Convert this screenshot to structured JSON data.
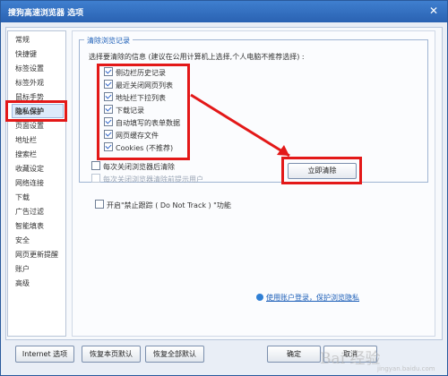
{
  "window": {
    "title": "搜狗高速浏览器 选项",
    "close": "✕"
  },
  "sidebar": {
    "items": [
      {
        "label": "常规"
      },
      {
        "label": "快捷键"
      },
      {
        "label": "标签设置"
      },
      {
        "label": "标签外观"
      },
      {
        "label": "鼠标手势"
      },
      {
        "label": "隐私保护"
      },
      {
        "label": "页面设置"
      },
      {
        "label": "地址栏"
      },
      {
        "label": "搜索栏"
      },
      {
        "label": "收藏设定"
      },
      {
        "label": "网络连接"
      },
      {
        "label": "下载"
      },
      {
        "label": "广告过滤"
      },
      {
        "label": "智能填表"
      },
      {
        "label": "安全"
      },
      {
        "label": "网页更新提醒"
      },
      {
        "label": "账户"
      },
      {
        "label": "高级"
      }
    ]
  },
  "privacy": {
    "group_title": "清除浏览记录",
    "hint": "选择要清除的信息 (建议在公用计算机上选择,个人电脑不推荐选择) :",
    "options": [
      {
        "label": "侧边栏历史记录",
        "checked": true
      },
      {
        "label": "最近关闭网页列表",
        "checked": true
      },
      {
        "label": "地址栏下拉列表",
        "checked": true
      },
      {
        "label": "下载记录",
        "checked": true
      },
      {
        "label": "自动填写的表单数据",
        "checked": true
      },
      {
        "label": "网页缓存文件",
        "checked": true
      },
      {
        "label": "Cookies (不推荐)",
        "checked": true
      }
    ],
    "clear_on_close": "每次关闭浏览器后清除",
    "prompt_before_clear": "每次关闭浏览器清除前提示用户",
    "clear_button": "立即清除",
    "do_not_track": "开启\"禁止跟踪 ( Do Not Track ) \"功能",
    "privacy_link": "使用账户登录，保护浏览隐私"
  },
  "footer": {
    "internet": "Internet 选项",
    "restore_page": "恢复本页默认",
    "restore_all": "恢复全部默认",
    "ok": "确定",
    "cancel": "取消"
  },
  "watermark": {
    "logo": "Bai 经验",
    "url": "jingyan.baidu.com"
  }
}
